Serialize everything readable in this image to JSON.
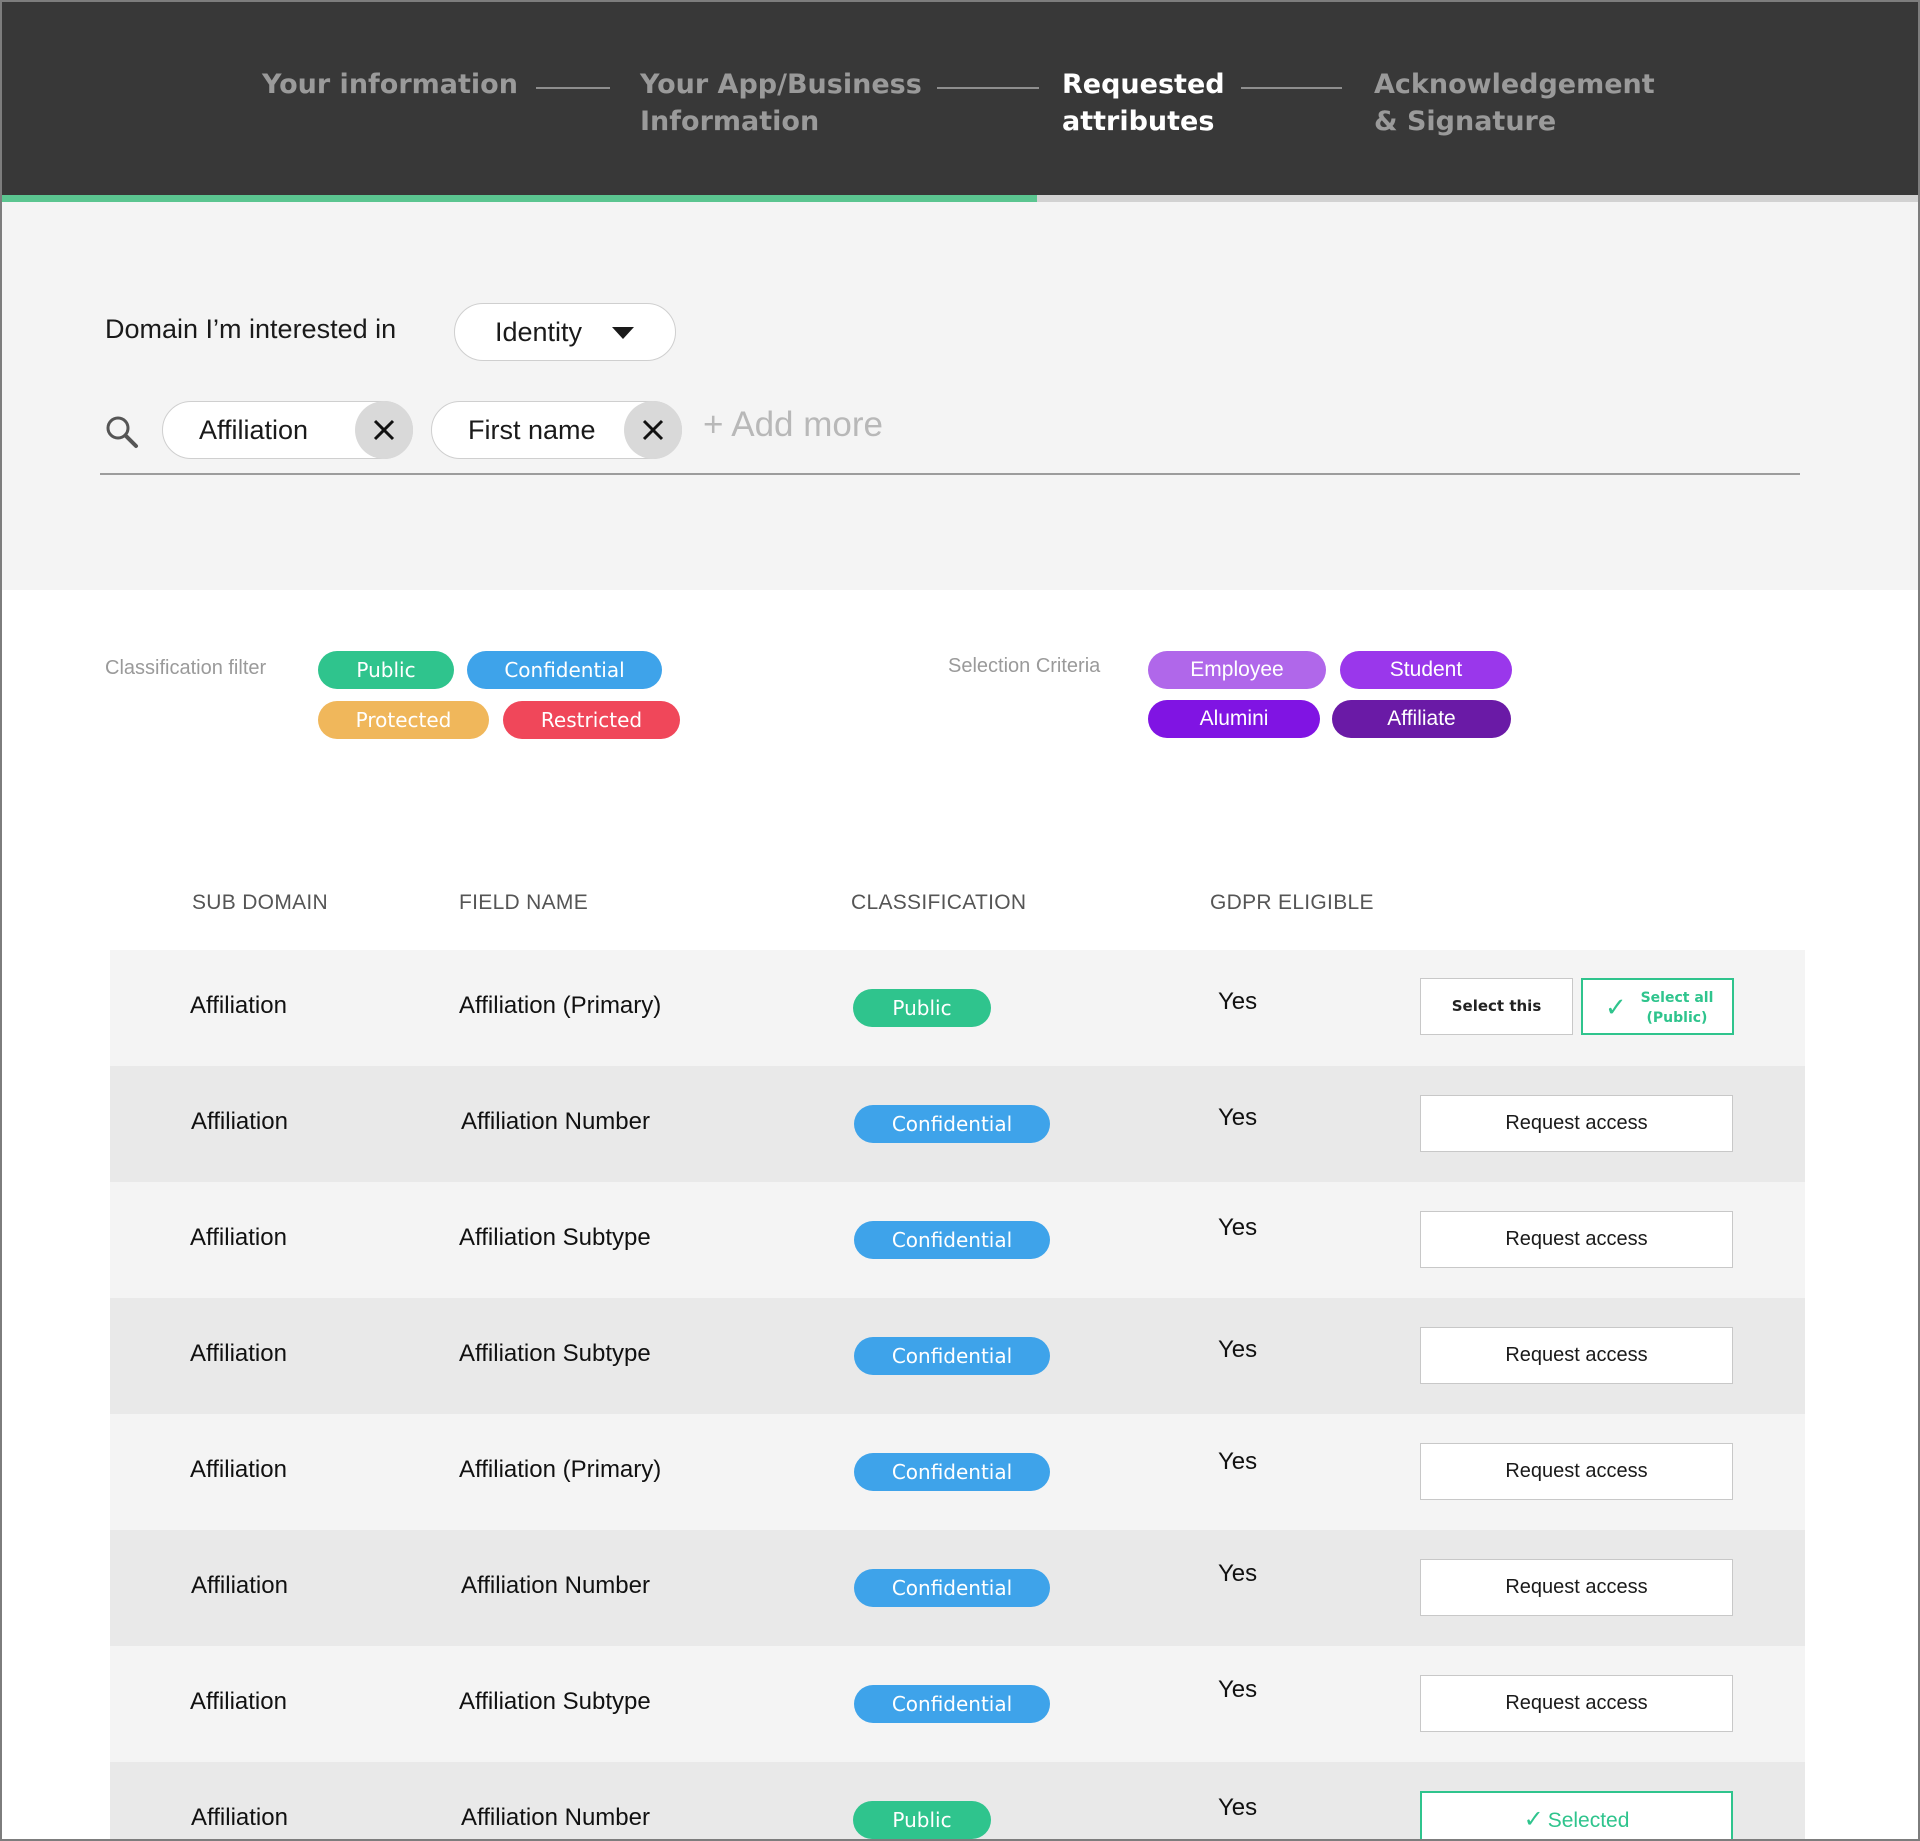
{
  "stepper": {
    "steps": [
      {
        "line1": "Your information",
        "line2": ""
      },
      {
        "line1": "Your App/Business",
        "line2": "Information"
      },
      {
        "line1": "Requested",
        "line2": "attributes"
      },
      {
        "line1": "Acknowledgement",
        "line2": "& Signature"
      }
    ],
    "active_step": 3,
    "progress_fraction": 0.54
  },
  "domain": {
    "label": "Domain I’m interested in",
    "selected": "Identity"
  },
  "search": {
    "chips": [
      "Affiliation",
      "First name"
    ],
    "add_more": "+ Add more"
  },
  "classification_filter": {
    "label": "Classification filter",
    "options": [
      "Public",
      "Confidential",
      "Protected",
      "Restricted"
    ]
  },
  "selection_criteria": {
    "label": "Selection Criteria",
    "options": [
      "Employee",
      "Student",
      "Alumini",
      "Affiliate"
    ]
  },
  "colors": {
    "public": "#2fc48d",
    "confidential": "#3ea3ea",
    "protected": "#f0b75b",
    "restricted": "#f0475a",
    "employee": "#b067ea",
    "student": "#9a37eb",
    "alumini": "#8014e3",
    "affiliate": "#6a1aa6",
    "accent_green": "#5bc590"
  },
  "table": {
    "headers": {
      "sub_domain": "SUB DOMAIN",
      "field_name": "FIELD NAME",
      "classification": "CLASSIFICATION",
      "gdpr": "GDPR ELIGIBLE"
    },
    "rows": [
      {
        "sub_domain": "Affiliation",
        "field_name": "Affiliation (Primary)",
        "classification": "Public",
        "gdpr": "Yes",
        "action": "select"
      },
      {
        "sub_domain": "Affiliation",
        "field_name": "Affiliation Number",
        "classification": "Confidential",
        "gdpr": "Yes",
        "action": "Request access"
      },
      {
        "sub_domain": "Affiliation",
        "field_name": "Affiliation Subtype",
        "classification": "Confidential",
        "gdpr": "Yes",
        "action": "Request access"
      },
      {
        "sub_domain": "Affiliation",
        "field_name": "Affiliation Subtype",
        "classification": "Confidential",
        "gdpr": "Yes",
        "action": "Request access"
      },
      {
        "sub_domain": "Affiliation",
        "field_name": "Affiliation (Primary)",
        "classification": "Confidential",
        "gdpr": "Yes",
        "action": "Request access"
      },
      {
        "sub_domain": "Affiliation",
        "field_name": "Affiliation Number",
        "classification": "Confidential",
        "gdpr": "Yes",
        "action": "Request access"
      },
      {
        "sub_domain": "Affiliation",
        "field_name": "Affiliation Subtype",
        "classification": "Confidential",
        "gdpr": "Yes",
        "action": "Request access"
      },
      {
        "sub_domain": "Affiliation",
        "field_name": "Affiliation Number",
        "classification": "Public",
        "gdpr": "Yes",
        "action": "Selected"
      }
    ],
    "select_this_label": "Select this",
    "select_all_label_line1": "Select all",
    "select_all_label_line2": "(Public)",
    "selected_label": "Selected"
  }
}
